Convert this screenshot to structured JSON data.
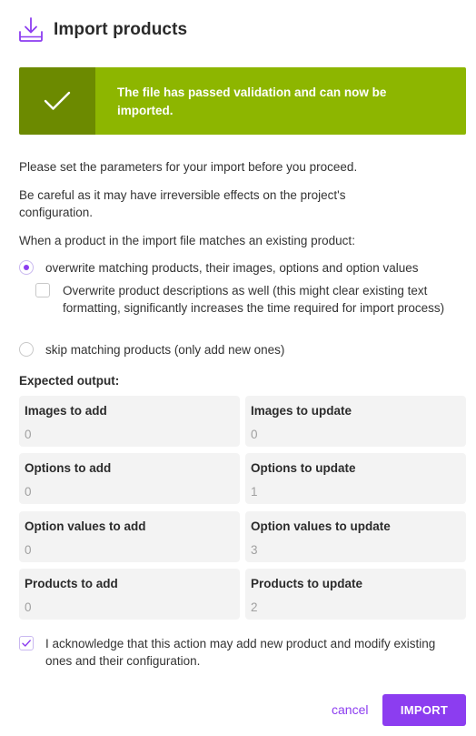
{
  "dialog": {
    "title": "Import products",
    "banner_message": "The file has passed validation and can now be imported.",
    "intro": "Please set the parameters for your import before you proceed.",
    "warning": "Be careful as it may have irreversible effects on the project's configuration.",
    "match_question": "When a product in the import file matches an existing product:"
  },
  "options": {
    "overwrite_label": "overwrite matching products, their images, options and option values",
    "overwrite_selected": true,
    "descriptions_label": "Overwrite product descriptions as well (this might clear existing text formatting, significantly increases the time required for import process)",
    "descriptions_checked": false,
    "skip_label": "skip matching products (only add new ones)",
    "skip_selected": false
  },
  "expected_output": {
    "title": "Expected output:",
    "cards": [
      {
        "label": "Images to add",
        "value": "0"
      },
      {
        "label": "Images to update",
        "value": "0"
      },
      {
        "label": "Options to add",
        "value": "0"
      },
      {
        "label": "Options to update",
        "value": "1"
      },
      {
        "label": "Option values to add",
        "value": "0"
      },
      {
        "label": "Option values to update",
        "value": "3"
      },
      {
        "label": "Products to add",
        "value": "0"
      },
      {
        "label": "Products to update",
        "value": "2"
      }
    ]
  },
  "acknowledge": {
    "label": "I acknowledge that this action may add new product and modify existing ones and their configuration.",
    "checked": true
  },
  "actions": {
    "cancel_label": "cancel",
    "import_label": "IMPORT"
  },
  "colors": {
    "accent": "#8c3df0",
    "banner_dark": "#6c8a00",
    "banner_light": "#8db600"
  }
}
